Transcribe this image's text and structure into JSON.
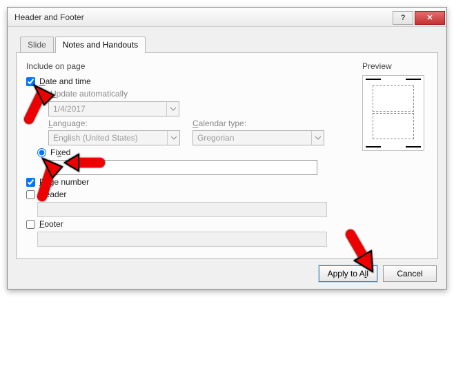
{
  "window": {
    "title": "Header and Footer",
    "help": "?",
    "close": "✕"
  },
  "tabs": {
    "slide": "Slide",
    "notes": "Notes and Handouts"
  },
  "group": {
    "include": "Include on page",
    "preview": "Preview"
  },
  "labels": {
    "datetime_D": "D",
    "datetime_rest": "ate and time",
    "update_U": "U",
    "update_rest": "pdate automatically",
    "language_L": "L",
    "language_rest": "anguage:",
    "calendar_C": "C",
    "calendar_rest": "alendar type:",
    "fixed_x": "x",
    "fixed_pre": "Fi",
    "fixed_post": "ed",
    "pagenum_P": "P",
    "pagenum_rest": "age number",
    "header_H": "H",
    "header_rest": "eader",
    "footer_F": "F",
    "footer_rest": "ooter"
  },
  "values": {
    "date_dd": "1/4/2017",
    "language_dd": "English (United States)",
    "calendar_dd": "Gregorian",
    "fixed_input": "",
    "header_input": "",
    "footer_input": ""
  },
  "buttons": {
    "apply_all_pre": "Apply to A",
    "apply_all_u": "l",
    "apply_all_post": "l",
    "cancel": "Cancel"
  },
  "state": {
    "datetime_checked": true,
    "update_auto_selected": false,
    "fixed_selected": true,
    "pagenum_checked": true,
    "header_checked": false,
    "footer_checked": false
  }
}
